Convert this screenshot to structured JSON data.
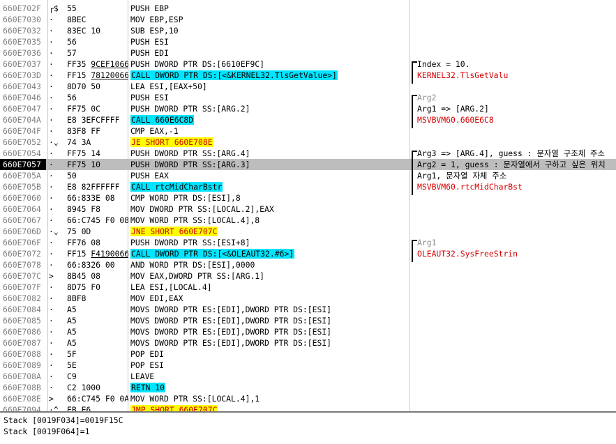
{
  "disassembly": {
    "selected_index": 14,
    "rows": [
      {
        "addr": "660E702F",
        "mark": "┌$",
        "hex": "55",
        "asm": [
          {
            "t": "PUSH EBP"
          }
        ],
        "com": []
      },
      {
        "addr": "660E7030",
        "mark": "·",
        "hex": "8BEC",
        "asm": [
          {
            "t": "MOV EBP,ESP"
          }
        ],
        "com": []
      },
      {
        "addr": "660E7032",
        "mark": "·",
        "hex": "83EC 10",
        "asm": [
          {
            "t": "SUB ESP,10"
          }
        ],
        "com": []
      },
      {
        "addr": "660E7035",
        "mark": "·",
        "hex": "56",
        "asm": [
          {
            "t": "PUSH ESI"
          }
        ],
        "com": []
      },
      {
        "addr": "660E7036",
        "mark": "·",
        "hex": "57",
        "asm": [
          {
            "t": "PUSH EDI"
          }
        ],
        "com": []
      },
      {
        "addr": "660E7037",
        "mark": "·",
        "hex": "FF35 9CEF1066",
        "hexu": "9CEF1066",
        "asm": [
          {
            "t": "PUSH DWORD PTR DS:[6610EF9C]"
          }
        ],
        "com": [
          {
            "t": "Index = 10.",
            "c": "dim2"
          }
        ]
      },
      {
        "addr": "660E703D",
        "mark": "·",
        "hex": "FF15 78120066",
        "hexu": "78120066",
        "asm": [
          {
            "t": "CALL DWORD PTR DS:[<&KERNEL32.TlsGetValue>]",
            "h": "call"
          }
        ],
        "com": [
          {
            "t": "KERNEL32.TlsGetValu",
            "c": "fn"
          }
        ]
      },
      {
        "addr": "660E7043",
        "mark": "·",
        "hex": "8D70 50",
        "asm": [
          {
            "t": "LEA ESI,[EAX+50]"
          }
        ],
        "com": []
      },
      {
        "addr": "660E7046",
        "mark": "·",
        "hex": "56",
        "asm": [
          {
            "t": "PUSH ESI"
          }
        ],
        "com": [
          {
            "t": "Arg2",
            "c": "dim"
          }
        ]
      },
      {
        "addr": "660E7047",
        "mark": "·",
        "hex": "FF75 0C",
        "asm": [
          {
            "t": "PUSH DWORD PTR SS:[ARG.2]"
          }
        ],
        "com": [
          {
            "t": "Arg1 => [ARG.2]",
            "c": "dim2"
          }
        ]
      },
      {
        "addr": "660E704A",
        "mark": "·",
        "hex": "E8 3EFCFFFF",
        "asm": [
          {
            "t": "CALL 660E6C8D",
            "h": "call"
          }
        ],
        "com": [
          {
            "t": "MSVBVM60.660E6C8",
            "c": "fn"
          }
        ]
      },
      {
        "addr": "660E704F",
        "mark": "·",
        "hex": "83F8 FF",
        "asm": [
          {
            "t": "CMP EAX,-1"
          }
        ],
        "com": []
      },
      {
        "addr": "660E7052",
        "mark": "·⌄",
        "hex": "74 3A",
        "asm": [
          {
            "t": "JE SHORT 660E708E",
            "h": "jmp"
          }
        ],
        "com": []
      },
      {
        "addr": "660E7054",
        "mark": "·",
        "hex": "FF75 14",
        "asm": [
          {
            "t": "PUSH DWORD PTR SS:[ARG.4]"
          }
        ],
        "com": [
          {
            "t": "Arg3 => [ARG.4], guess : 문자열 구조체 주소",
            "c": "dim2"
          }
        ]
      },
      {
        "addr": "660E7057",
        "mark": "·",
        "hex": "FF75 10",
        "asm": [
          {
            "t": "PUSH DWORD PTR SS:[ARG.3]"
          }
        ],
        "com": [
          {
            "t": "Arg2 = 1, guess : 문자열에서 구하고 싶은 위치",
            "c": "dim2"
          }
        ]
      },
      {
        "addr": "660E705A",
        "mark": "·",
        "hex": "50",
        "asm": [
          {
            "t": "PUSH EAX"
          }
        ],
        "com": [
          {
            "t": "Arg1, 문자열 자체 주소",
            "c": "dim2"
          }
        ]
      },
      {
        "addr": "660E705B",
        "mark": "·",
        "hex": "E8 82FFFFFF",
        "asm": [
          {
            "t": "CALL rtcMidCharBstr",
            "h": "call"
          }
        ],
        "com": [
          {
            "t": "MSVBVM60.rtcMidCharBst",
            "c": "fn"
          }
        ]
      },
      {
        "addr": "660E7060",
        "mark": "·",
        "hex": "66:833E 08",
        "asm": [
          {
            "t": "CMP WORD PTR DS:[ESI],8"
          }
        ],
        "com": []
      },
      {
        "addr": "660E7064",
        "mark": "·",
        "hex": "8945 F8",
        "asm": [
          {
            "t": "MOV DWORD PTR SS:[LOCAL.2],EAX"
          }
        ],
        "com": []
      },
      {
        "addr": "660E7067",
        "mark": "·",
        "hex": "66:C745 F0 08",
        "asm": [
          {
            "t": "MOV WORD PTR SS:[LOCAL.4],8"
          }
        ],
        "com": []
      },
      {
        "addr": "660E706D",
        "mark": "·⌄",
        "hex": "75 0D",
        "asm": [
          {
            "t": "JNE SHORT 660E707C",
            "h": "jmp"
          }
        ],
        "com": []
      },
      {
        "addr": "660E706F",
        "mark": "·",
        "hex": "FF76 08",
        "asm": [
          {
            "t": "PUSH DWORD PTR SS:[ESI+8]"
          }
        ],
        "com": [
          {
            "t": "Arg1",
            "c": "dim"
          }
        ]
      },
      {
        "addr": "660E7072",
        "mark": "·",
        "hex": "FF15 F4190066",
        "hexu": "F4190066",
        "asm": [
          {
            "t": "CALL DWORD PTR DS:[<&OLEAUT32.#6>]",
            "h": "call"
          }
        ],
        "com": [
          {
            "t": "OLEAUT32.SysFreeStrin",
            "c": "fn"
          }
        ]
      },
      {
        "addr": "660E7078",
        "mark": "·",
        "hex": "66:8326 00",
        "asm": [
          {
            "t": "AND WORD PTR DS:[ESI],0000"
          }
        ],
        "com": []
      },
      {
        "addr": "660E707C",
        "mark": ">",
        "hex": "8B45 08",
        "asm": [
          {
            "t": "MOV EAX,DWORD PTR SS:[ARG.1]"
          }
        ],
        "com": []
      },
      {
        "addr": "660E707F",
        "mark": "·",
        "hex": "8D75 F0",
        "asm": [
          {
            "t": "LEA ESI,[LOCAL.4]"
          }
        ],
        "com": []
      },
      {
        "addr": "660E7082",
        "mark": "·",
        "hex": "8BF8",
        "asm": [
          {
            "t": "MOV EDI,EAX"
          }
        ],
        "com": []
      },
      {
        "addr": "660E7084",
        "mark": "·",
        "hex": "A5",
        "asm": [
          {
            "t": "MOVS DWORD PTR ES:[EDI],DWORD PTR DS:[ESI]"
          }
        ],
        "com": []
      },
      {
        "addr": "660E7085",
        "mark": "·",
        "hex": "A5",
        "asm": [
          {
            "t": "MOVS DWORD PTR ES:[EDI],DWORD PTR DS:[ESI]"
          }
        ],
        "com": []
      },
      {
        "addr": "660E7086",
        "mark": "·",
        "hex": "A5",
        "asm": [
          {
            "t": "MOVS DWORD PTR ES:[EDI],DWORD PTR DS:[ESI]"
          }
        ],
        "com": []
      },
      {
        "addr": "660E7087",
        "mark": "·",
        "hex": "A5",
        "asm": [
          {
            "t": "MOVS DWORD PTR ES:[EDI],DWORD PTR DS:[ESI]"
          }
        ],
        "com": []
      },
      {
        "addr": "660E7088",
        "mark": "·",
        "hex": "5F",
        "asm": [
          {
            "t": "POP EDI"
          }
        ],
        "com": []
      },
      {
        "addr": "660E7089",
        "mark": "·",
        "hex": "5E",
        "asm": [
          {
            "t": "POP ESI"
          }
        ],
        "com": []
      },
      {
        "addr": "660E708A",
        "mark": "·",
        "hex": "C9",
        "asm": [
          {
            "t": "LEAVE"
          }
        ],
        "com": []
      },
      {
        "addr": "660E708B",
        "mark": "·",
        "hex": "C2 1000",
        "asm": [
          {
            "t": "RETN 10",
            "h": "retn"
          }
        ],
        "com": []
      },
      {
        "addr": "660E708E",
        "mark": ">",
        "hex": "66:C745 F0 0A",
        "asm": [
          {
            "t": "MOV WORD PTR SS:[LOCAL.4],1"
          }
        ],
        "com": []
      },
      {
        "addr": "660E7094",
        "mark": "·^",
        "hex": "EB E6",
        "asm": [
          {
            "t": "JMP SHORT 660E707C",
            "h": "jmp"
          }
        ],
        "com": []
      }
    ]
  },
  "status": {
    "line1": "Stack [0019F034]=0019F15C",
    "line2": "Stack [0019F064]=1"
  },
  "colors": {
    "call_highlight": "#00e5ff",
    "jump_highlight": "#ffff00",
    "jump_text": "#cc0000",
    "function_name": "#d40000",
    "selected_row": "#bdbdbd"
  }
}
